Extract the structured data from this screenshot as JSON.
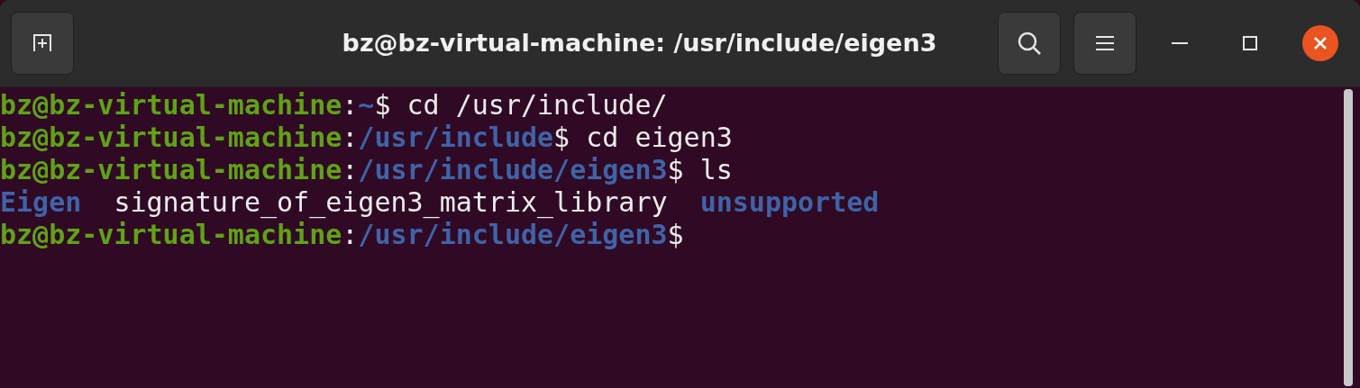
{
  "window": {
    "title": "bz@bz-virtual-machine: /usr/include/eigen3"
  },
  "terminal": {
    "lines": [
      [
        {
          "kind": "user",
          "text": "bz@bz-virtual-machine"
        },
        {
          "kind": "plain",
          "text": ":"
        },
        {
          "kind": "path",
          "text": "~"
        },
        {
          "kind": "plain",
          "text": "$ cd /usr/include/"
        }
      ],
      [
        {
          "kind": "user",
          "text": "bz@bz-virtual-machine"
        },
        {
          "kind": "plain",
          "text": ":"
        },
        {
          "kind": "path",
          "text": "/usr/include"
        },
        {
          "kind": "plain",
          "text": "$ cd eigen3"
        }
      ],
      [
        {
          "kind": "user",
          "text": "bz@bz-virtual-machine"
        },
        {
          "kind": "plain",
          "text": ":"
        },
        {
          "kind": "path",
          "text": "/usr/include/eigen3"
        },
        {
          "kind": "plain",
          "text": "$ ls"
        }
      ],
      [
        {
          "kind": "dir",
          "text": "Eigen"
        },
        {
          "kind": "plain",
          "text": "  signature_of_eigen3_matrix_library  "
        },
        {
          "kind": "dir",
          "text": "unsupported"
        }
      ],
      [
        {
          "kind": "user",
          "text": "bz@bz-virtual-machine"
        },
        {
          "kind": "plain",
          "text": ":"
        },
        {
          "kind": "path",
          "text": "/usr/include/eigen3"
        },
        {
          "kind": "plain",
          "text": "$"
        }
      ]
    ]
  }
}
